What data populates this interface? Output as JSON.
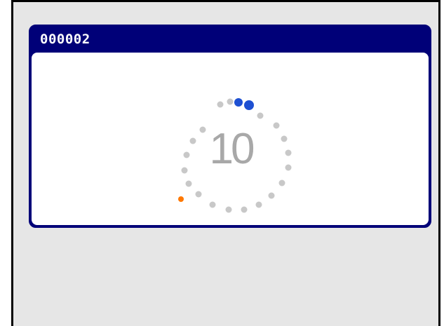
{
  "panel": {
    "title": "000002",
    "countdown": "10"
  },
  "spinner": {
    "dot_color": "#c8c8c8",
    "active_color": "#1e50d2",
    "marker_color": "#ff7800"
  },
  "colors": {
    "frame_background": "#e6e6e6",
    "panel_header": "#000078",
    "panel_body": "#ffffff"
  }
}
